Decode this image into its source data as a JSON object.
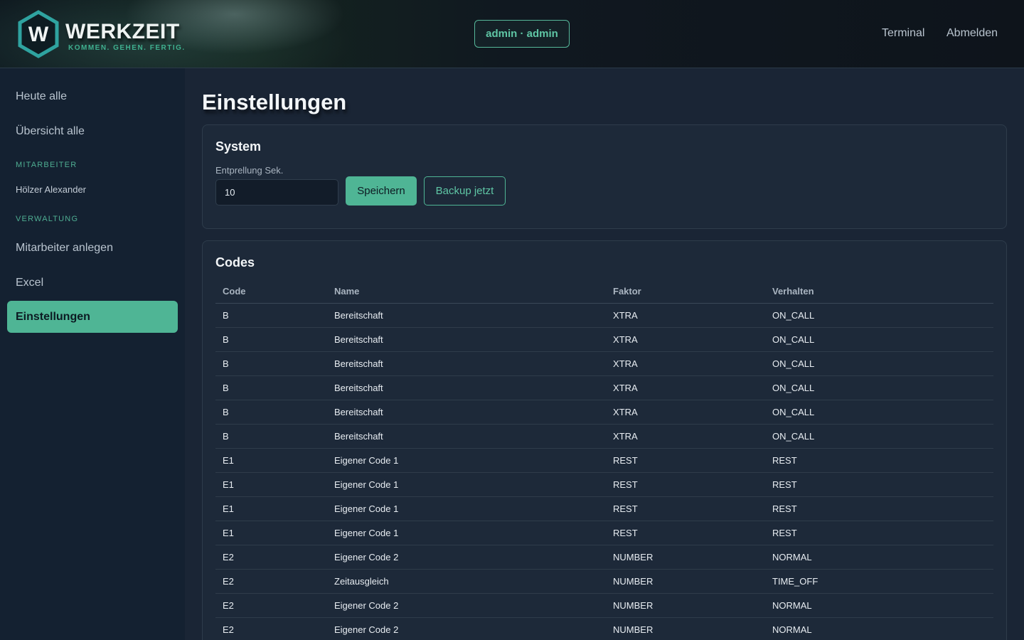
{
  "header": {
    "logo_letter": "W",
    "logo_title": "WERKZEIT",
    "logo_subtitle": "KOMMEN. GEHEN. FERTIG.",
    "user_badge": "admin · admin",
    "nav": [
      "Terminal",
      "Abmelden"
    ]
  },
  "sidebar": {
    "items_top": [
      "Heute alle",
      "Übersicht alle"
    ],
    "section_employees": "MITARBEITER",
    "employees": [
      "Hölzer Alexander"
    ],
    "section_admin": "VERWALTUNG",
    "items_admin": [
      "Mitarbeiter anlegen",
      "Excel"
    ],
    "active": "Einstellungen"
  },
  "page": {
    "title": "Einstellungen"
  },
  "system": {
    "title": "System",
    "debounce_label": "Entprellung Sek.",
    "debounce_value": "10",
    "save_label": "Speichern",
    "backup_label": "Backup jetzt"
  },
  "codes": {
    "title": "Codes",
    "columns": [
      "Code",
      "Name",
      "Faktor",
      "Verhalten"
    ],
    "rows": [
      [
        "B",
        "Bereitschaft",
        "XTRA",
        "ON_CALL"
      ],
      [
        "B",
        "Bereitschaft",
        "XTRA",
        "ON_CALL"
      ],
      [
        "B",
        "Bereitschaft",
        "XTRA",
        "ON_CALL"
      ],
      [
        "B",
        "Bereitschaft",
        "XTRA",
        "ON_CALL"
      ],
      [
        "B",
        "Bereitschaft",
        "XTRA",
        "ON_CALL"
      ],
      [
        "B",
        "Bereitschaft",
        "XTRA",
        "ON_CALL"
      ],
      [
        "E1",
        "Eigener Code 1",
        "REST",
        "REST"
      ],
      [
        "E1",
        "Eigener Code 1",
        "REST",
        "REST"
      ],
      [
        "E1",
        "Eigener Code 1",
        "REST",
        "REST"
      ],
      [
        "E1",
        "Eigener Code 1",
        "REST",
        "REST"
      ],
      [
        "E2",
        "Eigener Code 2",
        "NUMBER",
        "NORMAL"
      ],
      [
        "E2",
        "Zeitausgleich",
        "NUMBER",
        "TIME_OFF"
      ],
      [
        "E2",
        "Eigener Code 2",
        "NUMBER",
        "NORMAL"
      ],
      [
        "E2",
        "Eigener Code 2",
        "NUMBER",
        "NORMAL"
      ]
    ]
  },
  "colors": {
    "accent": "#4fb595",
    "background": "#1a2535",
    "sidebar": "#142131",
    "card": "#1d2939"
  }
}
